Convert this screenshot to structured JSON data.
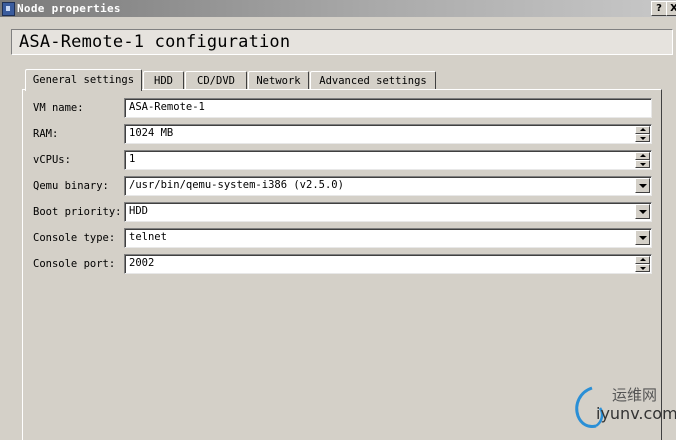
{
  "window": {
    "title": "Node properties",
    "help_button": "?",
    "close_button": "X"
  },
  "header": {
    "title": "ASA-Remote-1 configuration"
  },
  "tabs": [
    {
      "label": "General settings",
      "active": true
    },
    {
      "label": "HDD",
      "active": false
    },
    {
      "label": "CD/DVD",
      "active": false
    },
    {
      "label": "Network",
      "active": false
    },
    {
      "label": "Advanced settings",
      "active": false
    }
  ],
  "form": {
    "vm_name": {
      "label": "VM name:",
      "value": "ASA-Remote-1"
    },
    "ram": {
      "label": "RAM:",
      "value": "1024 MB"
    },
    "vcpus": {
      "label": "vCPUs:",
      "value": "1"
    },
    "qemu_binary": {
      "label": "Qemu binary:",
      "value": "/usr/bin/qemu-system-i386 (v2.5.0)"
    },
    "boot_priority": {
      "label": "Boot priority:",
      "value": "HDD"
    },
    "console_type": {
      "label": "Console type:",
      "value": "telnet"
    },
    "console_port": {
      "label": "Console port:",
      "value": "2002"
    }
  },
  "watermark": {
    "cn": "运维网",
    "en": "iyunv.com"
  }
}
